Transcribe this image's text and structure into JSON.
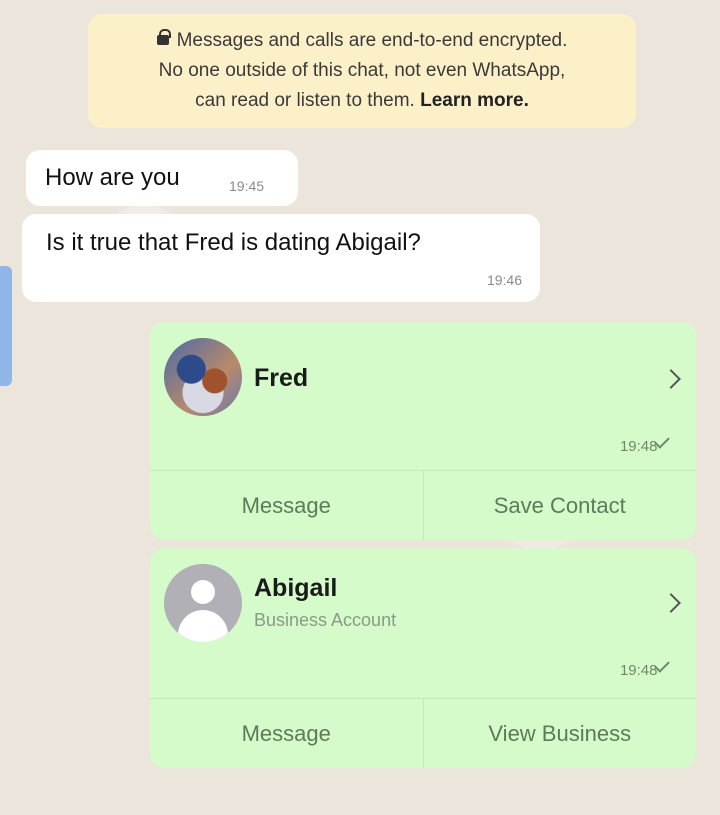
{
  "encryption": {
    "line1": "Messages and calls are end-to-end encrypted.",
    "line2": "No one outside of this chat, not even WhatsApp,",
    "line3": "can read or listen to them.",
    "learn_more": "Learn more."
  },
  "messages": [
    {
      "text": "How are you",
      "time": "19:45"
    },
    {
      "text": "Is it true that Fred is dating Abigail?",
      "time": "19:46"
    }
  ],
  "contacts": [
    {
      "name": "Fred",
      "subtitle": "",
      "time": "19:48",
      "action_left": "Message",
      "action_right": "Save Contact",
      "avatar_icon": "photo-avatar"
    },
    {
      "name": "Abigail",
      "subtitle": "Business Account",
      "time": "19:48",
      "action_left": "Message",
      "action_right": "View Business",
      "avatar_icon": "default-person-avatar"
    }
  ],
  "colors": {
    "chat_background": "#ece5dc",
    "encryption_banner": "#fbf0c8",
    "incoming_bubble": "#ffffff",
    "outgoing_card": "#d4fbc9",
    "side_tab": "#8fb6e6"
  }
}
